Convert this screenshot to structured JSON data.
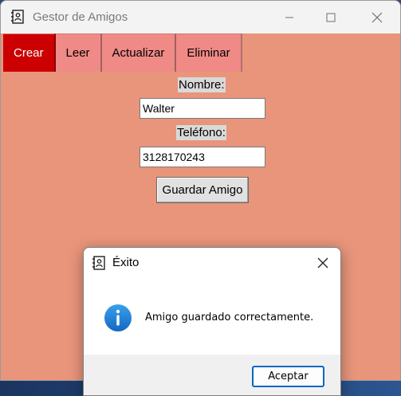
{
  "window": {
    "title": "Gestor de Amigos",
    "background": "#e8957b"
  },
  "tabs": [
    {
      "label": "Crear",
      "active": true
    },
    {
      "label": "Leer",
      "active": false
    },
    {
      "label": "Actualizar",
      "active": false
    },
    {
      "label": "Eliminar",
      "active": false
    }
  ],
  "form": {
    "nombre_label": "Nombre:",
    "nombre_value": "Walter",
    "telefono_label": "Teléfono:",
    "telefono_value": "3128170243",
    "save_label": "Guardar Amigo"
  },
  "dialog": {
    "title": "Éxito",
    "message": "Amigo guardado correctamente.",
    "ok_label": "Aceptar",
    "icon": "info-icon"
  },
  "colors": {
    "active_tab": "#cc0000",
    "inactive_tab": "#f08a86",
    "accent": "#0067c0"
  }
}
